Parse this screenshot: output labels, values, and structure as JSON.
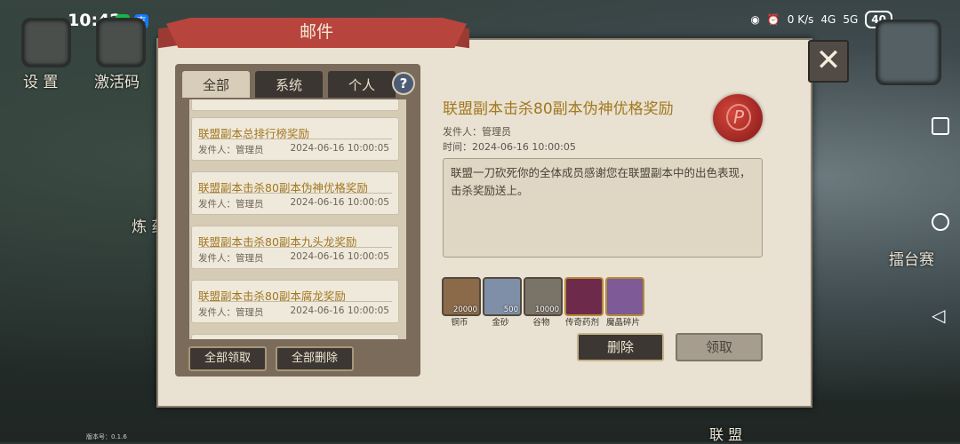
{
  "status_bar": {
    "time": "10:42",
    "net_speed": "0 K/s",
    "signal1": "4G",
    "signal2": "5G",
    "battery": "40"
  },
  "background_labels": {
    "settings": "设 置",
    "code": "激活码",
    "refine": "炼 药",
    "arena": "擂台赛",
    "alliance": "联 盟",
    "version": "版本号：0.1.6"
  },
  "dialog": {
    "title": "邮件",
    "close_symbol": "✕",
    "tabs": [
      {
        "label": "全部"
      },
      {
        "label": "系统"
      },
      {
        "label": "个人"
      }
    ],
    "help_symbol": "?",
    "mails": [
      {
        "title": "联盟副本总排行榜奖励",
        "sender": "发件人：管理员",
        "date": "2024-06-16 10:00:05"
      },
      {
        "title": "联盟副本击杀80副本伪神优格奖励",
        "sender": "发件人：管理员",
        "date": "2024-06-16 10:00:05"
      },
      {
        "title": "联盟副本击杀80副本九头龙奖励",
        "sender": "发件人：管理员",
        "date": "2024-06-16 10:00:05"
      },
      {
        "title": "联盟副本击杀80副本腐龙奖励",
        "sender": "发件人：管理员",
        "date": "2024-06-16 10:00:05"
      }
    ],
    "claim_all": "全部领取",
    "delete_all": "全部删除",
    "detail": {
      "title": "联盟副本击杀80副本伪神优格奖励",
      "sender": "发件人：管理员",
      "time": "时间：2024-06-16 10:00:05",
      "seal_letter": "P",
      "body": "联盟一刀砍死你的全体成员感谢您在联盟副本中的出色表现，击杀奖励送上。",
      "rewards": [
        {
          "name": "铜币",
          "count": "20000",
          "color": "#8b6a4a"
        },
        {
          "name": "金砂",
          "count": "500",
          "color": "#7f8fa8"
        },
        {
          "name": "谷物",
          "count": "10000",
          "color": "#7a7468"
        },
        {
          "name": "传奇药剂",
          "count": "",
          "color": "#6d2a4a"
        },
        {
          "name": "魔晶碎片",
          "count": "",
          "color": "#7e5a96"
        }
      ],
      "delete_label": "删除",
      "claim_label": "领取"
    }
  }
}
